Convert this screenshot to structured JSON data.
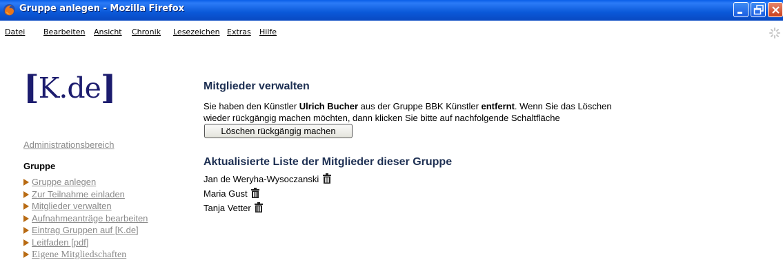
{
  "window": {
    "title": "Gruppe anlegen - Mozilla Firefox",
    "minimize_icon": "minimize-icon",
    "maximize_icon": "restore-icon",
    "close_icon": "close-icon"
  },
  "menu": {
    "items": [
      {
        "label": "Datei"
      },
      {
        "label": "Bearbeiten"
      },
      {
        "label": "Ansicht"
      },
      {
        "label": "Chronik"
      },
      {
        "label": "Lesezeichen"
      },
      {
        "label": "Extras"
      },
      {
        "label": "Hilfe"
      }
    ]
  },
  "logo": {
    "open": "[",
    "text": "K.de",
    "close": "]"
  },
  "sidebar": {
    "admin_link": "Administrationsbereich",
    "heading": "Gruppe",
    "items": [
      {
        "label": "Gruppe anlegen"
      },
      {
        "label": "Zur Teilnahme einladen "
      },
      {
        "label": "Mitglieder verwalten"
      },
      {
        "label": "Aufnahmeanträge bearbeiten"
      },
      {
        "label": "Eintrag Gruppen auf [K.de]"
      },
      {
        "label": "Leitfaden [pdf]"
      },
      {
        "label": "Eigene Mitgliedschaften"
      }
    ]
  },
  "main": {
    "title": "Mitglieder verwalten",
    "message": {
      "part1": "Sie haben den Künstler ",
      "name": "Ulrich Bucher",
      "part2": " aus der Gruppe BBK Künstler ",
      "action": "entfernt",
      "part3": ". Wenn Sie das Löschen wieder rückgängig machen möchten, dann klicken Sie bitte auf nachfolgende Schaltfläche"
    },
    "undo_button": "Löschen rückgängig machen",
    "list_title": "Aktualisierte Liste der Mitglieder dieser Gruppe",
    "members": [
      {
        "name": "Jan de Weryha-Wysoczanski"
      },
      {
        "name": "Maria Gust"
      },
      {
        "name": "Tanja Vetter"
      }
    ],
    "delete_icon": "trash-icon"
  },
  "colors": {
    "titlebar": "#0a58d8",
    "heading": "#1d2f52",
    "logo": "#1c1c6e",
    "link_gray": "#8a8a8a",
    "arrow": "#b86a12"
  }
}
